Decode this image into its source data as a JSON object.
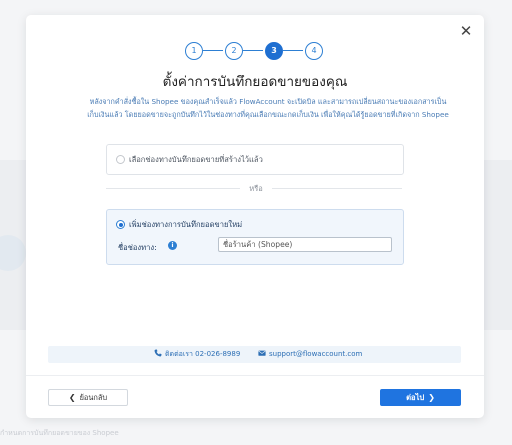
{
  "background": {
    "bottom_text": "กำหนดการบันทึกยอดขายของ Shopee"
  },
  "modal": {
    "close_icon": "close-icon",
    "steps": [
      "1",
      "2",
      "3",
      "4"
    ],
    "active_step": "3",
    "title": "ตั้งค่าการบันทึกยอดขายของคุณ",
    "description_line1": "หลังจากคำสั่งซื้อใน Shopee ของคุณสำเร็จแล้ว FlowAccount จะเปิดบิล และสามารถเปลี่ยนสถานะของเอกสารเป็น",
    "description_line2": "เก็บเงินแล้ว โดยยอดขายจะถูกบันทึกไว้ในช่องทางที่คุณเลือกขณะกดเก็บเงิน เพื่อให้คุณได้รู้ยอดขายที่เกิดจาก Shopee",
    "option_existing_label": "เลือกช่องทางบันทึกยอดขายที่สร้างไว้แล้ว",
    "or_label": "หรือ",
    "option_new_label": "เพิ่มช่องทางการบันทึกยอดขายใหม่",
    "channel_name_label": "ชื่อช่องทาง:",
    "info_icon": "info-icon",
    "channel_name_value": "ชื่อร้านค้า (Shopee)",
    "contact_phone": "ติดต่อเรา 02-026-8989",
    "contact_email": "support@flowaccount.com",
    "back_button": "ย้อนกลับ",
    "next_button": "ต่อไป",
    "colors": {
      "primary": "#1f74e0",
      "link": "#2d6fb5",
      "description": "#4a7cb5"
    }
  }
}
